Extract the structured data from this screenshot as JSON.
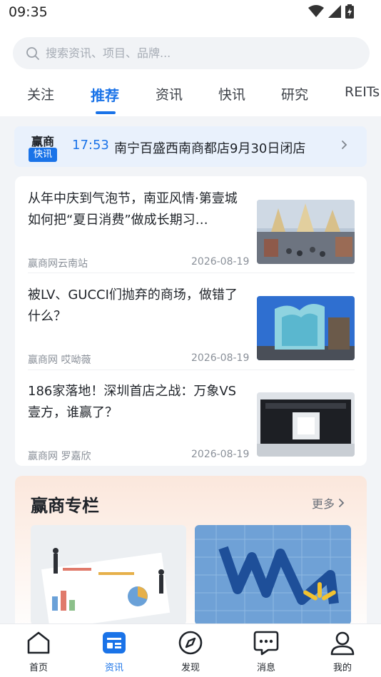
{
  "status_bar": {
    "time": "09:35",
    "icons": [
      "wifi-icon",
      "signal-icon",
      "battery-icon"
    ]
  },
  "search": {
    "placeholder": "搜索资讯、项目、品牌..."
  },
  "tabs": [
    {
      "label": "关注",
      "active": false
    },
    {
      "label": "推荐",
      "active": true
    },
    {
      "label": "资讯",
      "active": false
    },
    {
      "label": "快讯",
      "active": false
    },
    {
      "label": "研究",
      "active": false
    },
    {
      "label": "REITs",
      "active": false
    }
  ],
  "flash_news": {
    "brand": "赢商",
    "tag": "快讯",
    "time": "17:53",
    "title": "南宁百盛西南商都店9月30日闭店"
  },
  "news": [
    {
      "title": "从年中庆到气泡节，南亚风情·第壹城如何把“夏日消费”做成长期习…",
      "source": "赢商网云南站",
      "date": "2026-08-19"
    },
    {
      "title": "被LV、GUCCI们抛弃的商场，做错了什么？",
      "source": "赢商网 哎呦薇",
      "date": "2026-08-19"
    },
    {
      "title": "186家落地！深圳首店之战：万象VS壹方，谁赢了？",
      "source": "赢商网 罗嘉欣",
      "date": "2026-08-19"
    }
  ],
  "column": {
    "title": "赢商专栏",
    "more": "更多"
  },
  "bottom_nav": [
    {
      "label": "首页",
      "icon": "home-icon",
      "active": false
    },
    {
      "label": "资讯",
      "icon": "news-icon",
      "active": true
    },
    {
      "label": "发现",
      "icon": "compass-icon",
      "active": false
    },
    {
      "label": "消息",
      "icon": "message-icon",
      "active": false
    },
    {
      "label": "我的",
      "icon": "profile-icon",
      "active": false
    }
  ],
  "colors": {
    "accent": "#1a73e8",
    "text": "#1f2329",
    "muted": "#8a9099",
    "background": "#f2f4f7"
  }
}
